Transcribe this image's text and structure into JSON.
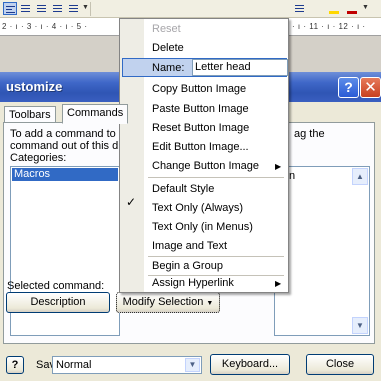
{
  "window": {
    "title": "ustomize"
  },
  "ruler": {
    "left_scale": "2 · ı · 3 · ı · 4 · ı · 5 ·",
    "right_scale": "· ı · 11 · ı · 12 · ı ·"
  },
  "tabs": [
    {
      "label": "Toolbars"
    },
    {
      "label": "Commands"
    }
  ],
  "instructions": {
    "line1": "To add a command to a",
    "line2": "command out of this di",
    "right": "ag the"
  },
  "categories": {
    "label": "Categories:",
    "selected": "Macros"
  },
  "commands": {
    "visible_fragment": "n"
  },
  "selected_command": {
    "label": "Selected command:",
    "description_button": "Description",
    "modify_button": "Modify Selection"
  },
  "bottom": {
    "save_in_label": "Save in:",
    "save_in_value": "Normal",
    "keyboard_button": "Keyboard...",
    "close_button": "Close"
  },
  "context_menu": {
    "items": [
      {
        "label": "Reset",
        "enabled": false
      },
      {
        "label": "Delete",
        "enabled": true
      },
      {
        "label": "Name:",
        "value": "Letter head"
      },
      {
        "label": "Copy Button Image"
      },
      {
        "label": "Paste Button Image"
      },
      {
        "label": "Reset Button Image"
      },
      {
        "label": "Edit Button Image..."
      },
      {
        "label": "Change Button Image",
        "submenu": true
      },
      {
        "label": "Default Style",
        "checked": true
      },
      {
        "label": "Text Only (Always)"
      },
      {
        "label": "Text Only (in Menus)"
      },
      {
        "label": "Image and Text"
      },
      {
        "label": "Begin a Group"
      },
      {
        "label": "Assign Hyperlink",
        "submenu": true
      }
    ]
  },
  "icons": {
    "help": "?",
    "close": "✕",
    "check": "✓",
    "submenu": "▶",
    "dropdown": "▼",
    "scroll_up": "▲",
    "scroll_down": "▼"
  },
  "colors": {
    "titlebar": "#2f55b4",
    "selection": "#316ac5",
    "menu_highlight": "#c1d2ee",
    "dialog_bg": "#ece9d8"
  }
}
